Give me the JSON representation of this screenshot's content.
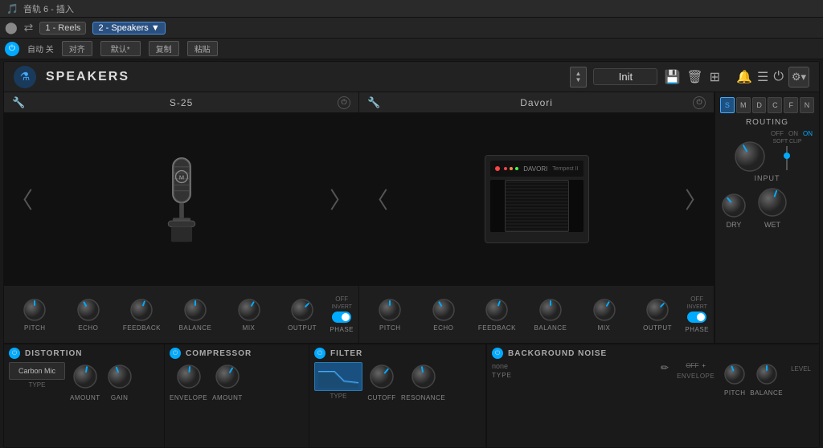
{
  "titlebar": {
    "title": "音轨 6 - 插入"
  },
  "trackbar": {
    "slot1": "1 - Reels",
    "slot2": "2 - Speakers",
    "dropdown_arrow": "▼"
  },
  "controlsbar": {
    "power_on": true,
    "auto_label": "自动 关",
    "align_btn": "对齐",
    "default_btn": "默认*",
    "copy_btn": "复制",
    "paste_btn": "粘贴"
  },
  "plugin": {
    "logo_icon": "flask",
    "title": "SPEAKERS",
    "preset_up": "▲",
    "preset_down": "▼",
    "preset_name": "Init",
    "save_icon": "💾",
    "delete_icon": "🗑",
    "settings_icon": "⚙",
    "menu_icon": "☰",
    "power_icon": "⏻",
    "bell_icon": "🔔"
  },
  "channel1": {
    "name": "S-25",
    "knobs": [
      {
        "label": "PITCH",
        "value": 50
      },
      {
        "label": "ECHO",
        "value": 40
      },
      {
        "label": "FEEDBACK",
        "value": 45
      },
      {
        "label": "BALANCE",
        "value": 50
      },
      {
        "label": "MIX",
        "value": 55
      },
      {
        "label": "OUTPUT",
        "value": 60
      }
    ],
    "phase": {
      "off_label": "OFF",
      "on_label": "",
      "invert_label": "INVERT",
      "phase_label": "PHASE"
    }
  },
  "channel2": {
    "name": "Davori",
    "knobs": [
      {
        "label": "PITCH",
        "value": 50
      },
      {
        "label": "ECHO",
        "value": 40
      },
      {
        "label": "FEEDBACK",
        "value": 45
      },
      {
        "label": "BALANCE",
        "value": 50
      },
      {
        "label": "MIX",
        "value": 55
      },
      {
        "label": "OUTPUT",
        "value": 60
      }
    ],
    "phase": {
      "off_label": "OFF",
      "on_label": "",
      "invert_label": "INVERT",
      "phase_label": "PHASE"
    }
  },
  "routing": {
    "tabs": [
      "S",
      "M",
      "D",
      "C",
      "F",
      "N"
    ],
    "active_tab": "S",
    "label": "ROUTING",
    "off_label": "OFF",
    "on_label": "ON",
    "soft_clip": "SOFT CLIP",
    "input_label": "INPUT",
    "dry_label": "DRY",
    "wet_label": "WET"
  },
  "effects": {
    "distortion": {
      "name": "DISTORTION",
      "type_label": "TYPE",
      "type_value": "Carbon Mic",
      "knobs": [
        {
          "label": "AMOUNT",
          "value": 50
        },
        {
          "label": "GAIN",
          "value": 45
        }
      ]
    },
    "compressor": {
      "name": "COMPRESSOR",
      "knobs": [
        {
          "label": "ENVELOPE",
          "value": 50
        },
        {
          "label": "AMOUNT",
          "value": 55
        }
      ]
    },
    "filter": {
      "name": "FILTER",
      "type_label": "TYPE",
      "knobs": [
        {
          "label": "CUTOFF",
          "value": 60
        },
        {
          "label": "RESONANCE",
          "value": 40
        }
      ]
    },
    "background_noise": {
      "name": "BACKGROUND NOISE",
      "type_none": "none",
      "type_label": "TYPE",
      "pencil": "✏",
      "off_label": "OFF",
      "plus_label": "+",
      "envelope_label": "ENVELOPE",
      "level_label": "LEVEL",
      "knobs": [
        {
          "label": "PITCH",
          "value": 45
        },
        {
          "label": "BALANCE",
          "value": 50
        }
      ]
    }
  }
}
